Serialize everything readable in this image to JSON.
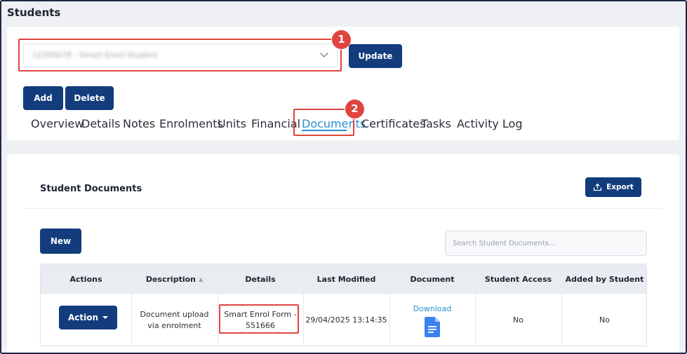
{
  "page": {
    "title": "Students"
  },
  "student_select": {
    "value": "12345678 - Smart Enrol Student"
  },
  "buttons": {
    "update": "Update",
    "add": "Add",
    "delete": "Delete",
    "export": "Export",
    "new": "New",
    "action": "Action"
  },
  "tabs": [
    {
      "label": "Overview",
      "active": false
    },
    {
      "label": "Details",
      "active": false
    },
    {
      "label": "Notes",
      "active": false
    },
    {
      "label": "Enrolments",
      "active": false
    },
    {
      "label": "Units",
      "active": false
    },
    {
      "label": "Financial",
      "active": false
    },
    {
      "label": "Documents",
      "active": true
    },
    {
      "label": "Certificates",
      "active": false
    },
    {
      "label": "Tasks",
      "active": false
    },
    {
      "label": "Activity Log",
      "active": false
    }
  ],
  "badges": {
    "one": "1",
    "two": "2"
  },
  "documents": {
    "section_title": "Student Documents",
    "search_placeholder": "Search Student Documents...",
    "columns": [
      "Actions",
      "Description",
      "Details",
      "Last Modified",
      "Document",
      "Student Access",
      "Added by Student"
    ],
    "rows": [
      {
        "description": "Document upload via enrolment",
        "details": "Smart Enrol Form - 551666",
        "last_modified": "29/04/2025 13:14:35",
        "document_link": "Download",
        "student_access": "No",
        "added_by_student": "No"
      }
    ]
  },
  "colors": {
    "primary": "#123c7c",
    "highlight": "#e0443f",
    "link": "#2a8fd4"
  },
  "icons": {
    "export": "upload-icon",
    "document": "google-doc-icon",
    "dropdown": "chevron-down-icon"
  }
}
